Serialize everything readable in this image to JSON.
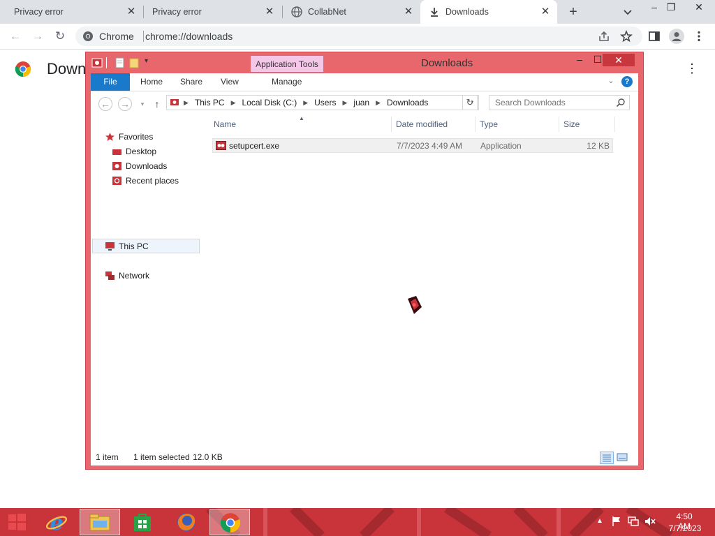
{
  "chrome": {
    "tabs": [
      {
        "label": "Privacy error",
        "active": false
      },
      {
        "label": "Privacy error",
        "active": false
      },
      {
        "label": "CollabNet",
        "active": false
      },
      {
        "label": "Downloads",
        "active": true
      }
    ],
    "omnibox": {
      "chip": "Chrome",
      "url": "chrome://downloads"
    },
    "page": {
      "title": "Down"
    }
  },
  "explorer": {
    "title": "Downloads",
    "context_tab": "Application Tools",
    "ribbon_tabs": {
      "file": "File",
      "home": "Home",
      "share": "Share",
      "view": "View",
      "manage": "Manage"
    },
    "breadcrumb": [
      "This PC",
      "Local Disk (C:)",
      "Users",
      "juan",
      "Downloads"
    ],
    "search_placeholder": "Search Downloads",
    "nav": {
      "favorites": "Favorites",
      "desktop": "Desktop",
      "downloads": "Downloads",
      "recent": "Recent places",
      "this_pc": "This PC",
      "network": "Network"
    },
    "columns": {
      "name": "Name",
      "date": "Date modified",
      "type": "Type",
      "size": "Size"
    },
    "files": [
      {
        "name": "setupcert.exe",
        "date": "7/7/2023 4:49 AM",
        "type": "Application",
        "size": "12 KB"
      }
    ],
    "status": {
      "count": "1 item",
      "selected": "1 item selected",
      "size": "12.0 KB"
    }
  },
  "taskbar": {
    "time": "4:50 AM",
    "date": "7/7/2023",
    "accent": "#c8343a"
  }
}
